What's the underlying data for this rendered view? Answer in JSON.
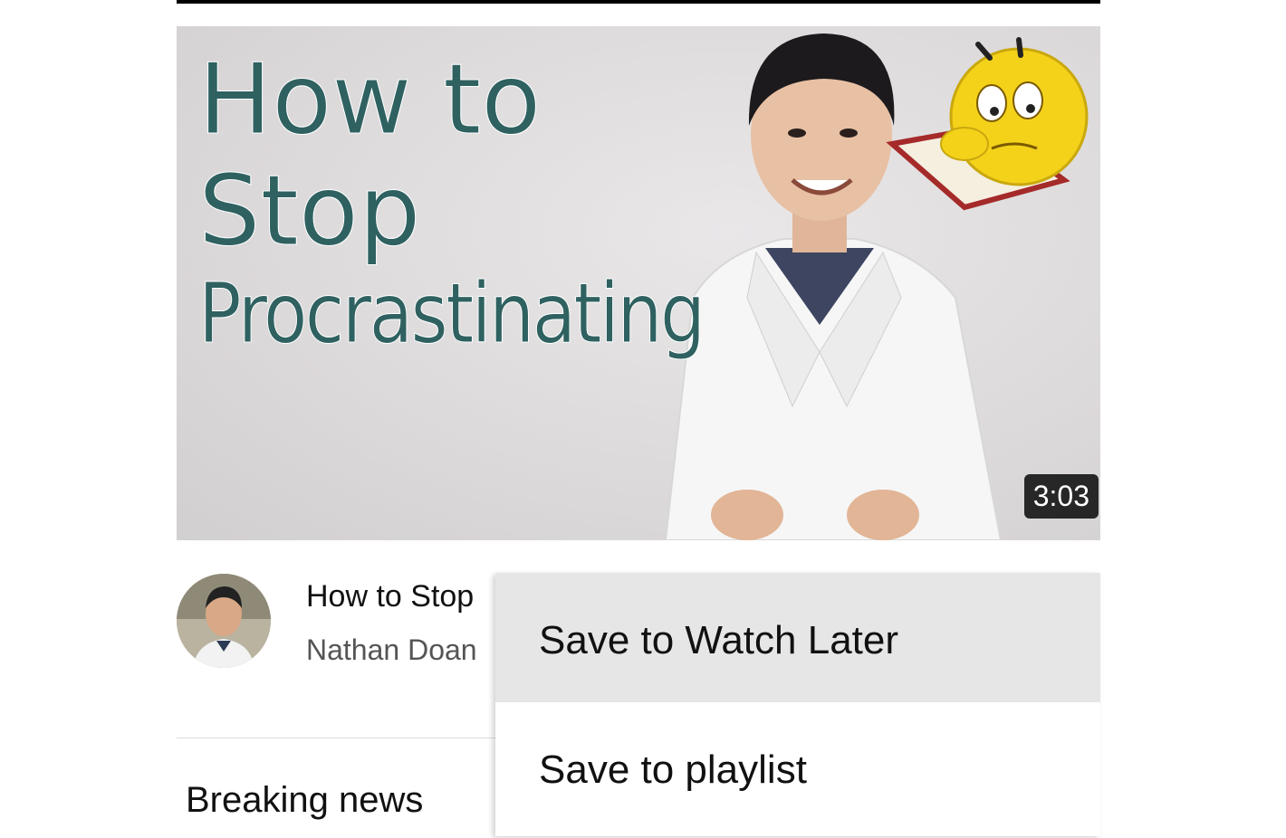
{
  "thumbnail": {
    "title_lines": [
      "How to",
      "Stop",
      "Procrastinating"
    ],
    "duration": "3:03"
  },
  "video": {
    "title": "How to Stop",
    "channel": "Nathan Doan"
  },
  "section": {
    "label": "Breaking news"
  },
  "menu": {
    "items": [
      {
        "label": "Save to Watch Later"
      },
      {
        "label": "Save to playlist"
      }
    ]
  },
  "colors": {
    "title_text": "#2f6161",
    "menu_highlight": "#e6e6e6",
    "duration_badge": "#000000"
  }
}
